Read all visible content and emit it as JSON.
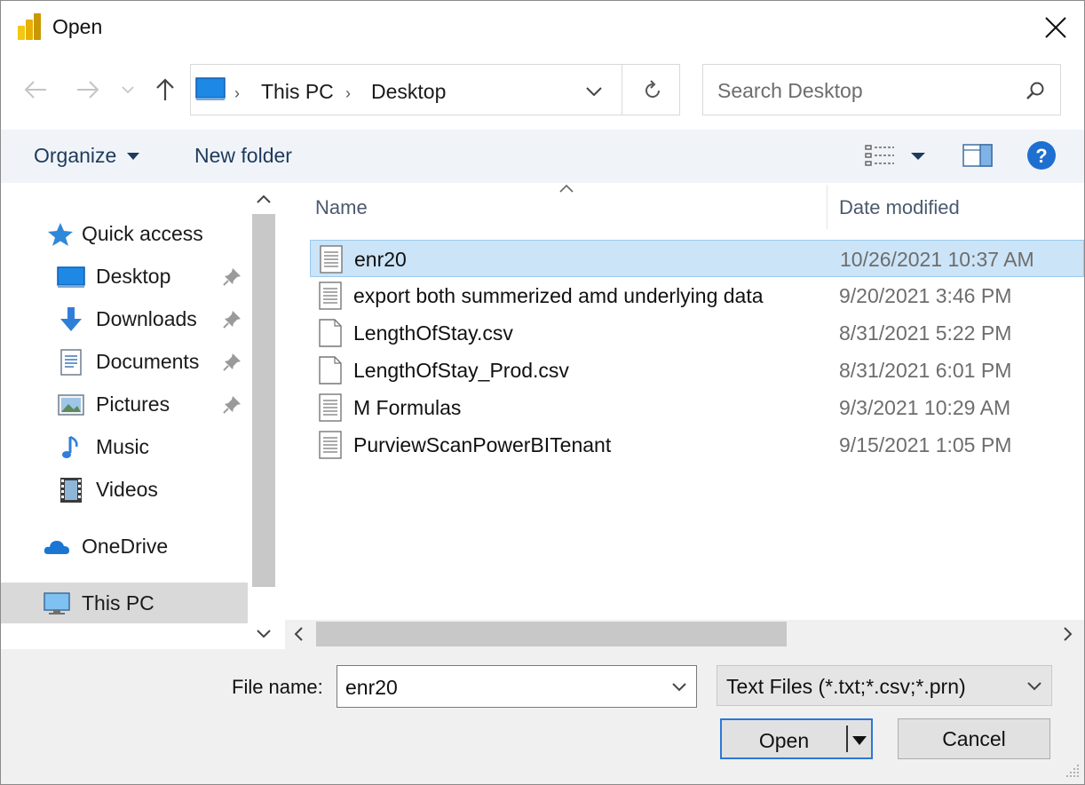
{
  "window": {
    "title": "Open"
  },
  "address_bar": {
    "crumbs": [
      "This PC",
      "Desktop"
    ]
  },
  "search": {
    "placeholder": "Search Desktop"
  },
  "toolbar": {
    "organize_label": "Organize",
    "new_folder_label": "New folder"
  },
  "nav_pane": {
    "items": [
      {
        "label": "Quick access",
        "icon": "star-icon"
      },
      {
        "label": "Desktop",
        "icon": "desktop-icon",
        "pinned": true
      },
      {
        "label": "Downloads",
        "icon": "download-arrow-icon",
        "pinned": true
      },
      {
        "label": "Documents",
        "icon": "documents-icon",
        "pinned": true
      },
      {
        "label": "Pictures",
        "icon": "pictures-icon",
        "pinned": true
      },
      {
        "label": "Music",
        "icon": "music-note-icon"
      },
      {
        "label": "Videos",
        "icon": "film-icon"
      },
      {
        "label": "OneDrive",
        "icon": "cloud-icon"
      },
      {
        "label": "This PC",
        "icon": "computer-icon",
        "selected": true
      }
    ]
  },
  "file_list": {
    "columns": [
      "Name",
      "Date modified"
    ],
    "rows": [
      {
        "name": "enr20",
        "date": "10/26/2021 10:37 AM",
        "icon": "text-file-icon",
        "selected": true
      },
      {
        "name": "export both summerized amd underlying data",
        "date": "9/20/2021 3:46 PM",
        "icon": "text-file-icon"
      },
      {
        "name": "LengthOfStay.csv",
        "date": "8/31/2021 5:22 PM",
        "icon": "blank-file-icon"
      },
      {
        "name": "LengthOfStay_Prod.csv",
        "date": "8/31/2021 6:01 PM",
        "icon": "blank-file-icon"
      },
      {
        "name": "M Formulas",
        "date": "9/3/2021 10:29 AM",
        "icon": "text-file-icon"
      },
      {
        "name": "PurviewScanPowerBITenant",
        "date": "9/15/2021 1:05 PM",
        "icon": "text-file-icon"
      }
    ]
  },
  "bottom": {
    "file_name_label": "File name:",
    "file_name_value": "enr20",
    "file_type_value": "Text Files (*.txt;*.csv;*.prn)",
    "open_label": "Open",
    "cancel_label": "Cancel"
  },
  "colors": {
    "accent": "#2d77d8",
    "selection": "#cce4f7",
    "help_icon": "#1f6fd1"
  }
}
